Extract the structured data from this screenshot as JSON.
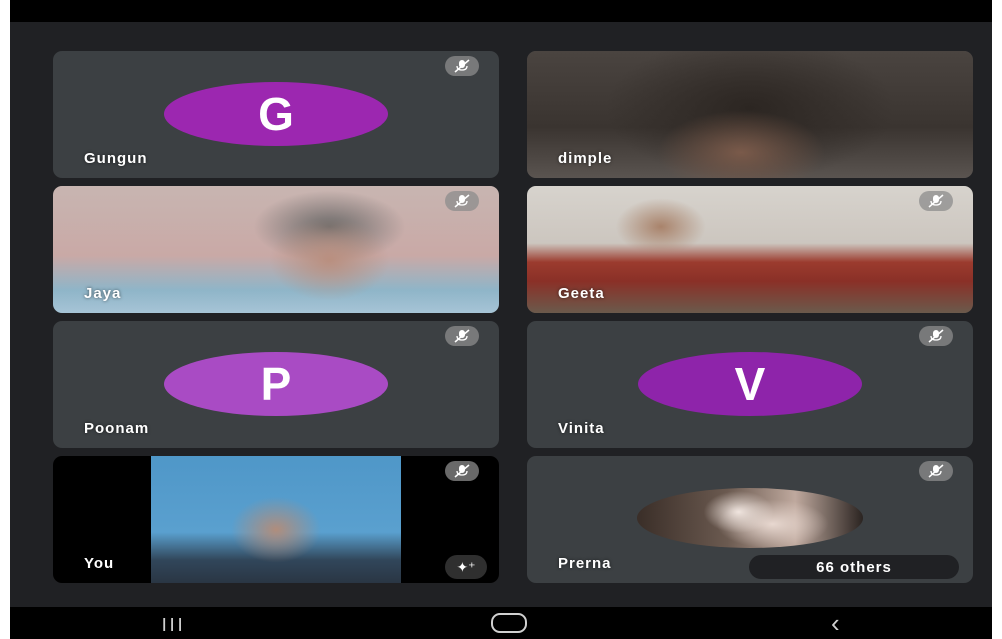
{
  "colors": {
    "tile_bg": "#3c4043",
    "screen_bg": "#202124",
    "avatar_purple": "#9c27b0"
  },
  "participants": [
    {
      "name": "Gungun",
      "initial": "G",
      "muted": true,
      "type": "avatar"
    },
    {
      "name": "dimple",
      "muted": false,
      "type": "video"
    },
    {
      "name": "Jaya",
      "muted": true,
      "type": "video"
    },
    {
      "name": "Geeta",
      "muted": true,
      "type": "video"
    },
    {
      "name": "Poonam",
      "initial": "P",
      "muted": true,
      "type": "avatar"
    },
    {
      "name": "Vinita",
      "initial": "V",
      "muted": true,
      "type": "avatar"
    },
    {
      "name": "You",
      "muted": true,
      "type": "self-video"
    },
    {
      "name": "Prerna",
      "muted": true,
      "type": "photo-avatar",
      "others_label": "66 others"
    }
  ],
  "system_nav": {
    "recent_icon": "recent-apps-icon",
    "home_icon": "home-icon",
    "back_icon": "back-icon"
  }
}
